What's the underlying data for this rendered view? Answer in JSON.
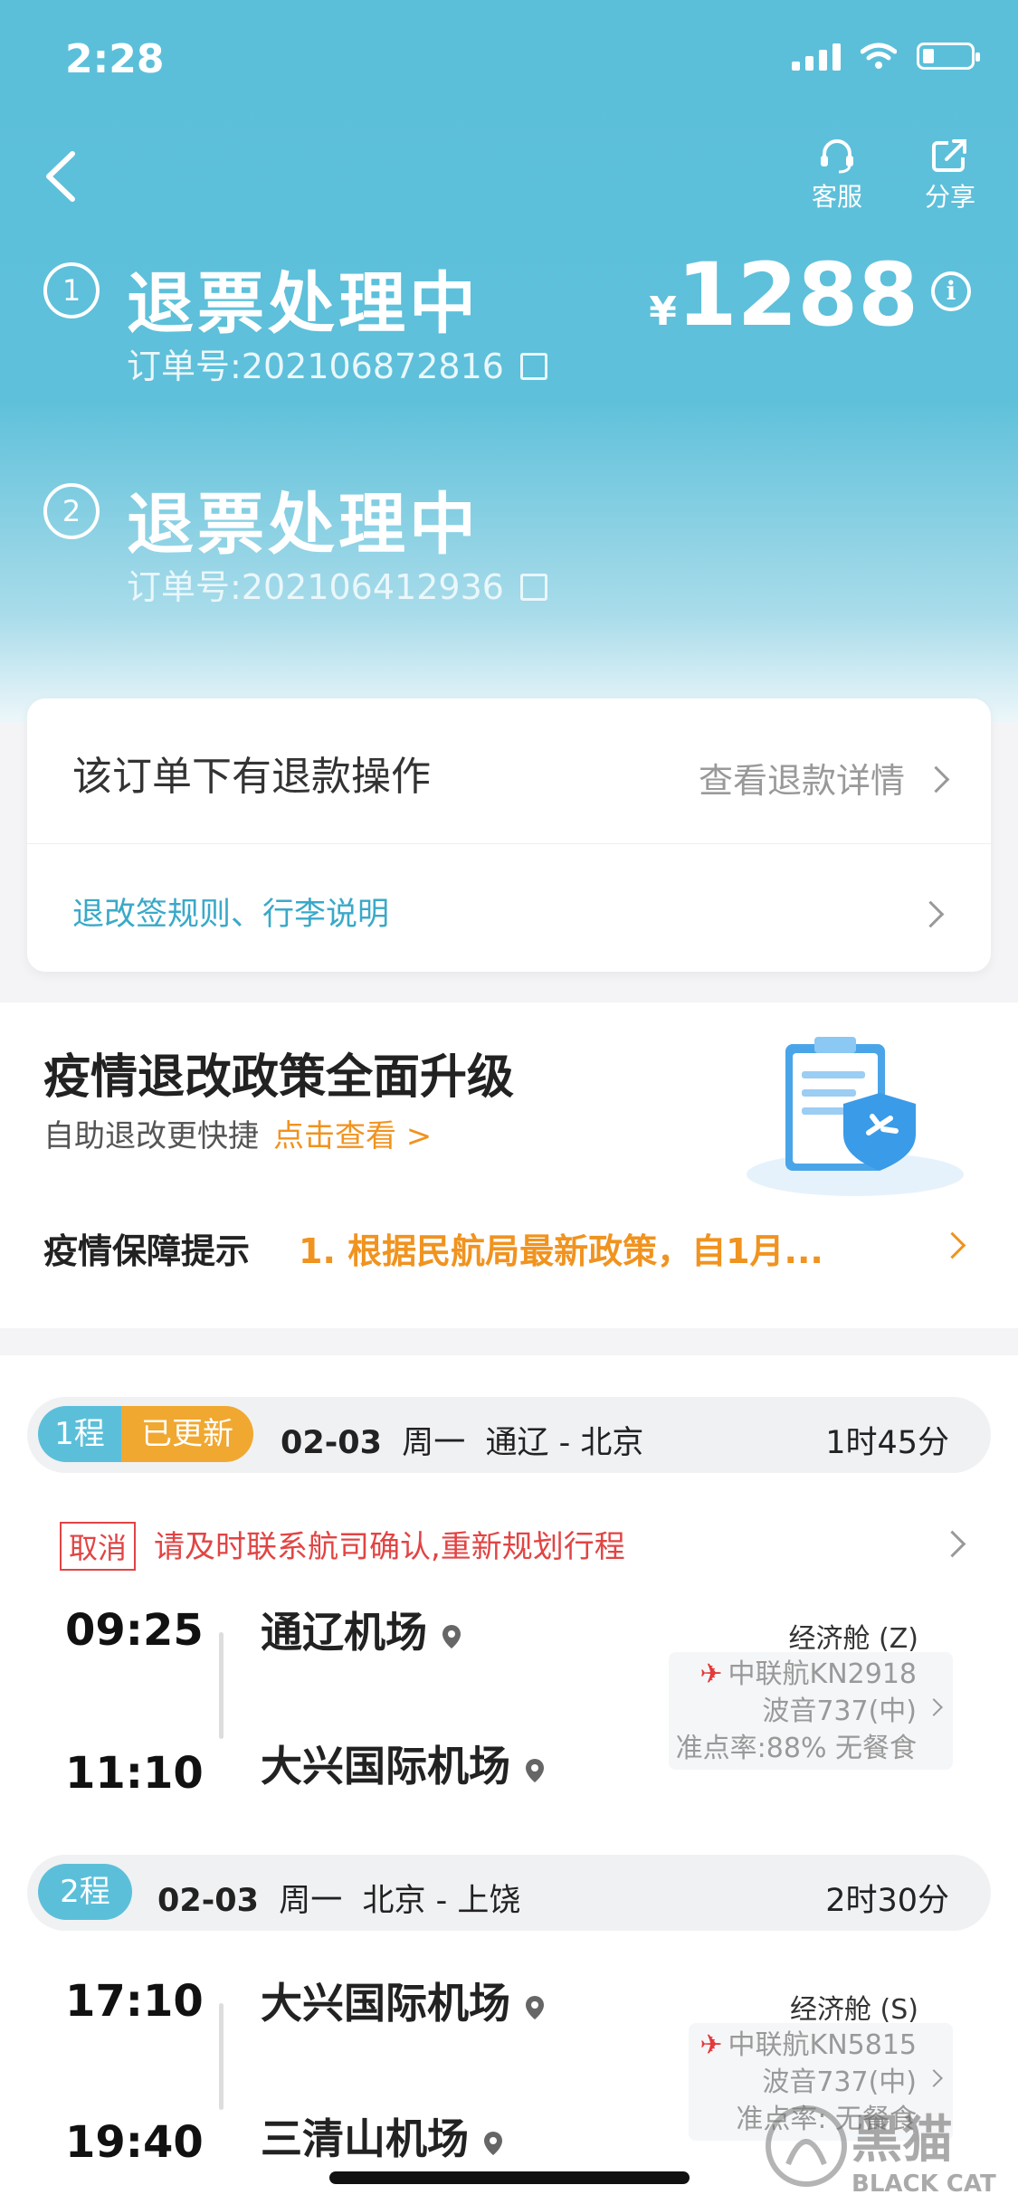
{
  "status": {
    "time": "2:28"
  },
  "header": {
    "service_label": "客服",
    "share_label": "分享"
  },
  "orders": [
    {
      "index": "1",
      "status": "退票处理中",
      "order_no": "订单号:202106872816"
    },
    {
      "index": "2",
      "status": "退票处理中",
      "order_no": "订单号:202106412936"
    }
  ],
  "price": {
    "currency": "¥",
    "amount": "1288"
  },
  "refund_card": {
    "title": "该订单下有退款操作",
    "detail_link": "查看退款详情",
    "rules_link": "退改签规则、行李说明"
  },
  "policy": {
    "title": "疫情退改政策全面升级",
    "subtitle": "自助退改更快捷",
    "subtitle_link": "点击查看 >",
    "tip_label": "疫情保障提示",
    "tip_text": "1. 根据民航局最新政策，自1月..."
  },
  "segments": [
    {
      "leg": "1程",
      "badge": "已更新",
      "date": "02-03",
      "weekday": "周一",
      "route": "通辽 - 北京",
      "duration": "1时45分",
      "cancel_tag": "取消",
      "cancel_text": "请及时联系航司确认,重新规划行程",
      "dep_time": "09:25",
      "dep_airport": "通辽机场",
      "arr_time": "11:10",
      "arr_airport": "大兴国际机场",
      "cabin": "经济舱 (Z)",
      "flight": "中联航KN2918",
      "aircraft": "波音737(中)",
      "ontime": "准点率:88% 无餐食"
    },
    {
      "leg": "2程",
      "date": "02-03",
      "weekday": "周一",
      "route": "北京 - 上饶",
      "duration": "2时30分",
      "dep_time": "17:10",
      "dep_airport": "大兴国际机场",
      "arr_time": "19:40",
      "arr_airport": "三清山机场",
      "cabin": "经济舱 (S)",
      "flight": "中联航KN5815",
      "aircraft": "波音737(中)",
      "ontime": "准点率:    无餐食"
    }
  ],
  "colors": {
    "accent": "#5cbfda",
    "orange": "#f0931f",
    "red": "#e24444"
  },
  "watermark": {
    "text": "黑猫",
    "sub": "BLACK CAT"
  }
}
